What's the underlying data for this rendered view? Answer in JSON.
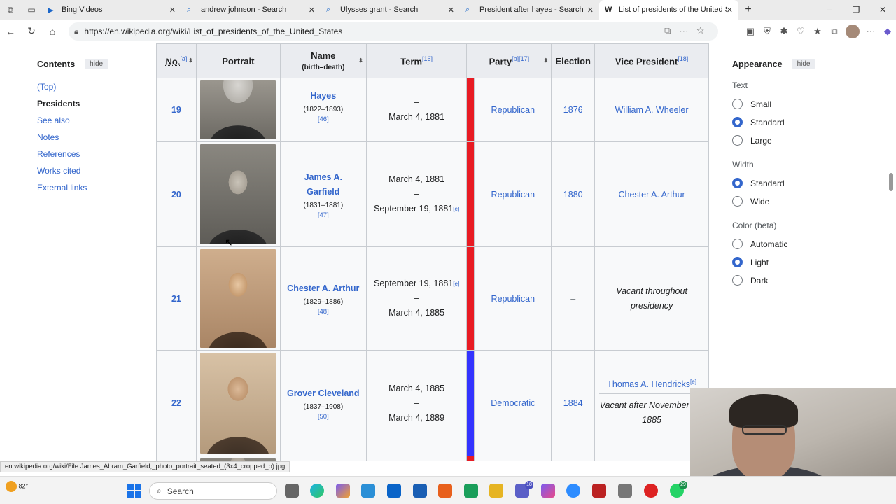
{
  "tabs": [
    {
      "label": "Bing Videos",
      "icon": "bing-icon"
    },
    {
      "label": "andrew johnson - Search",
      "icon": "search-icon"
    },
    {
      "label": "Ulysses grant - Search",
      "icon": "search-icon"
    },
    {
      "label": "President after hayes - Search",
      "icon": "search-icon"
    },
    {
      "label": "List of presidents of the United St",
      "icon": "wikipedia-icon"
    }
  ],
  "address": {
    "url": "https://en.wikipedia.org/wiki/List_of_presidents_of_the_United_States"
  },
  "toc": {
    "title": "Contents",
    "hide": "hide",
    "items": [
      "(Top)",
      "Presidents",
      "See also",
      "Notes",
      "References",
      "Works cited",
      "External links"
    ]
  },
  "table": {
    "headers": {
      "no": "No.",
      "no_ref": "[a]",
      "portrait": "Portrait",
      "name": "Name",
      "name_sub": "(birth–death)",
      "term": "Term",
      "term_ref": "[16]",
      "party": "Party",
      "party_ref": "[b][17]",
      "election": "Election",
      "vp": "Vice President",
      "vp_ref": "[18]"
    },
    "rows": [
      {
        "no": "19",
        "name": "Hayes",
        "dates": "(1822–1893)",
        "ref": "[46]",
        "term_start": "–",
        "term_mid": "March 4, 1881",
        "party": "Republican",
        "party_color": "#e81b23",
        "election": "1876",
        "vp": "William A. Wheeler"
      },
      {
        "no": "20",
        "name": "James A. Garfield",
        "dates": "(1831–1881)",
        "ref": "[47]",
        "term_start": "March 4, 1881",
        "term_mid": "–",
        "term_end": "September 19, 1881",
        "term_end_ref": "[e]",
        "party": "Republican",
        "party_color": "#e81b23",
        "election": "1880",
        "vp": "Chester A. Arthur"
      },
      {
        "no": "21",
        "name": "Chester A. Arthur",
        "dates": "(1829–1886)",
        "ref": "[48]",
        "term_start": "September 19, 1881",
        "term_start_ref": "[e]",
        "term_mid": "–",
        "term_end": "March 4, 1885",
        "party": "Republican",
        "party_color": "#e81b23",
        "election": "–",
        "vp_italic": "Vacant throughout presidency"
      },
      {
        "no": "22",
        "name": "Grover Cleveland",
        "dates": "(1837–1908)",
        "ref": "[50]",
        "term_start": "March 4, 1885",
        "term_mid": "–",
        "term_end": "March 4, 1889",
        "party": "Democratic",
        "party_color": "#3333ff",
        "election": "1884",
        "vp": "Thomas A. Hendricks",
        "vp_ref": "[e]",
        "vp_italic": "Vacant after November 25, 1885"
      }
    ]
  },
  "appearance": {
    "title": "Appearance",
    "hide": "hide",
    "text_label": "Text",
    "text_options": [
      "Small",
      "Standard",
      "Large"
    ],
    "text_selected": "Standard",
    "width_label": "Width",
    "width_options": [
      "Standard",
      "Wide"
    ],
    "width_selected": "Standard",
    "color_label": "Color (beta)",
    "color_options": [
      "Automatic",
      "Light",
      "Dark"
    ],
    "color_selected": "Light"
  },
  "status_url": "en.wikipedia.org/wiki/File:James_Abram_Garfield,_photo_portrait_seated_(3x4_cropped_b).jpg",
  "taskbar": {
    "weather": "82°",
    "search_placeholder": "Search",
    "badges": {
      "teams": "18",
      "whatsapp": "29"
    }
  }
}
